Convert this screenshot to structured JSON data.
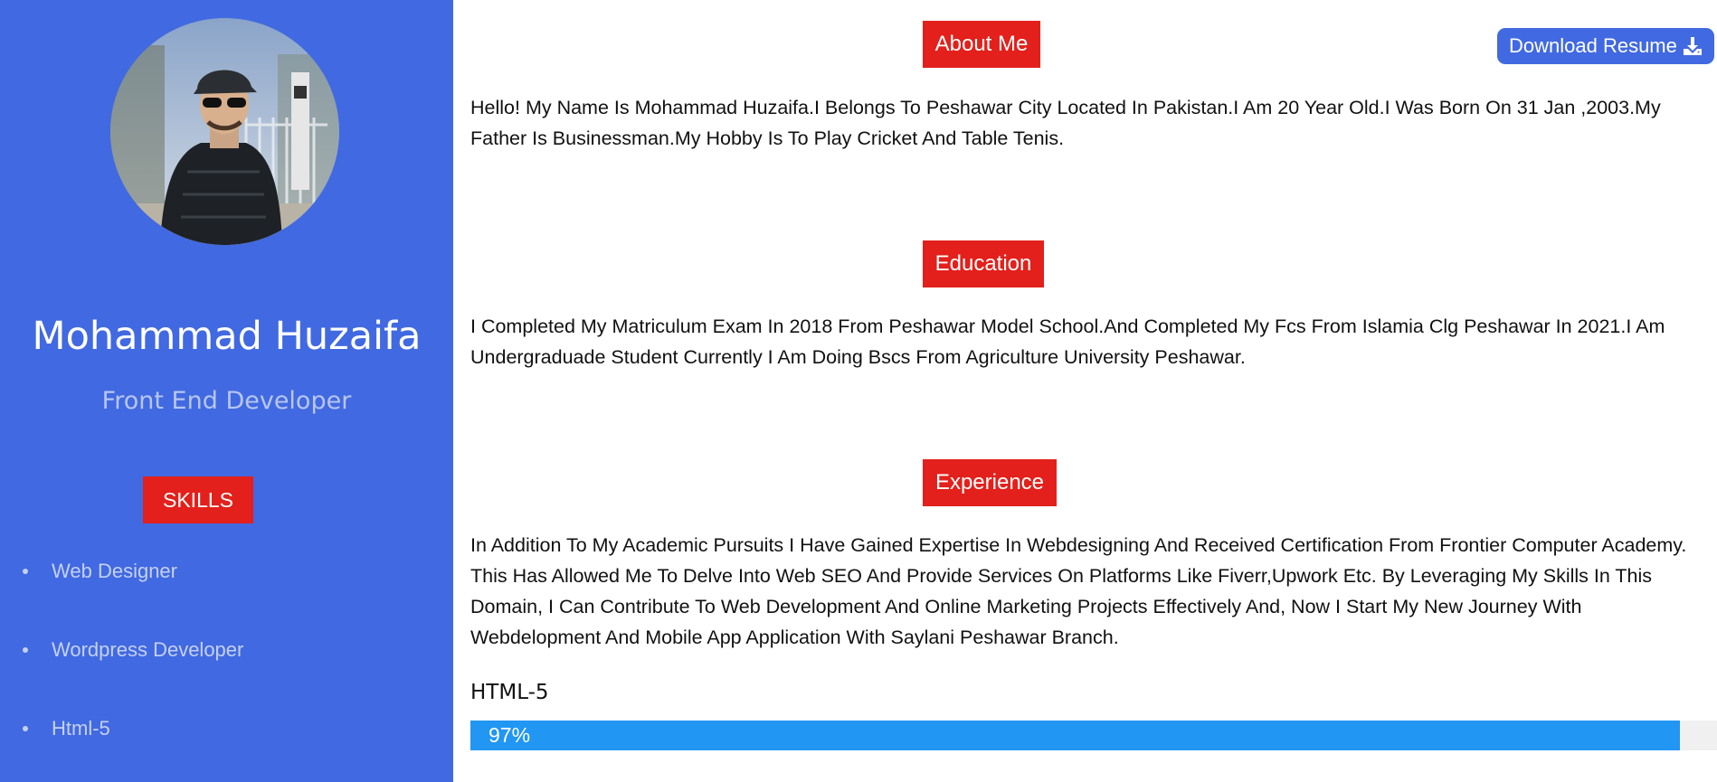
{
  "profile": {
    "name": "Mohammad Huzaifa",
    "role": "Front End Developer"
  },
  "sidebar": {
    "skills_heading": "SKILLS",
    "skills": [
      "Web Designer",
      "Wordpress Developer",
      "Html-5"
    ]
  },
  "toolbar": {
    "download_label": "Download Resume",
    "download_icon": "download-icon"
  },
  "sections": [
    {
      "title": "About Me",
      "text": "Hello! My Name Is Mohammad Huzaifa.I Belongs To Peshawar City Located In Pakistan.I Am 20 Year Old.I Was Born On 31 Jan ,2003.My Father Is Businessman.My Hobby Is To Play Cricket And Table Tenis."
    },
    {
      "title": "Education",
      "text": "I Completed My Matriculum Exam In 2018 From Peshawar Model School.And Completed My Fcs From Islamia Clg Peshawar In 2021.I Am Undergraduade Student Currently I Am Doing Bscs From Agriculture University Peshawar."
    },
    {
      "title": "Experience",
      "text": "In Addition To My Academic Pursuits I Have Gained Expertise In Webdesigning And Received Certification From Frontier Computer Academy. This Has Allowed Me To Delve Into Web SEO And Provide Services On Platforms Like Fiverr,Upwork Etc. By Leveraging My Skills In This Domain, I Can Contribute To Web Development And Online Marketing Projects Effectively And, Now I Start My New Journey With Webdelopment And Mobile App Application With Saylani Peshawar Branch."
    }
  ],
  "progress": {
    "label": "HTML-5",
    "value_text": "97%",
    "value_percent": 97
  },
  "colors": {
    "sidebar": "#4169e1",
    "accent_red": "#e3201b",
    "progress_fill": "#2196f3"
  }
}
